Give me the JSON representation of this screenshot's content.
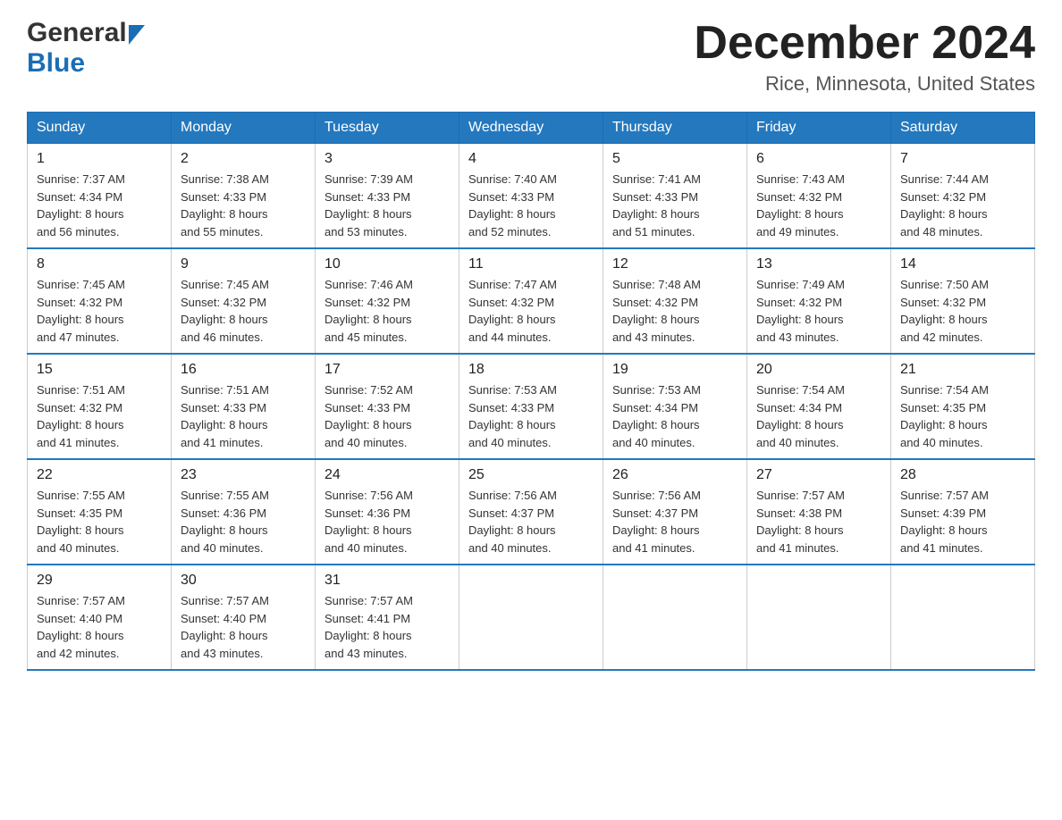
{
  "header": {
    "logo_general": "General",
    "logo_blue": "Blue",
    "month_title": "December 2024",
    "location": "Rice, Minnesota, United States"
  },
  "weekdays": [
    "Sunday",
    "Monday",
    "Tuesday",
    "Wednesday",
    "Thursday",
    "Friday",
    "Saturday"
  ],
  "weeks": [
    [
      {
        "day": "1",
        "sunrise": "7:37 AM",
        "sunset": "4:34 PM",
        "daylight": "8 hours and 56 minutes."
      },
      {
        "day": "2",
        "sunrise": "7:38 AM",
        "sunset": "4:33 PM",
        "daylight": "8 hours and 55 minutes."
      },
      {
        "day": "3",
        "sunrise": "7:39 AM",
        "sunset": "4:33 PM",
        "daylight": "8 hours and 53 minutes."
      },
      {
        "day": "4",
        "sunrise": "7:40 AM",
        "sunset": "4:33 PM",
        "daylight": "8 hours and 52 minutes."
      },
      {
        "day": "5",
        "sunrise": "7:41 AM",
        "sunset": "4:33 PM",
        "daylight": "8 hours and 51 minutes."
      },
      {
        "day": "6",
        "sunrise": "7:43 AM",
        "sunset": "4:32 PM",
        "daylight": "8 hours and 49 minutes."
      },
      {
        "day": "7",
        "sunrise": "7:44 AM",
        "sunset": "4:32 PM",
        "daylight": "8 hours and 48 minutes."
      }
    ],
    [
      {
        "day": "8",
        "sunrise": "7:45 AM",
        "sunset": "4:32 PM",
        "daylight": "8 hours and 47 minutes."
      },
      {
        "day": "9",
        "sunrise": "7:45 AM",
        "sunset": "4:32 PM",
        "daylight": "8 hours and 46 minutes."
      },
      {
        "day": "10",
        "sunrise": "7:46 AM",
        "sunset": "4:32 PM",
        "daylight": "8 hours and 45 minutes."
      },
      {
        "day": "11",
        "sunrise": "7:47 AM",
        "sunset": "4:32 PM",
        "daylight": "8 hours and 44 minutes."
      },
      {
        "day": "12",
        "sunrise": "7:48 AM",
        "sunset": "4:32 PM",
        "daylight": "8 hours and 43 minutes."
      },
      {
        "day": "13",
        "sunrise": "7:49 AM",
        "sunset": "4:32 PM",
        "daylight": "8 hours and 43 minutes."
      },
      {
        "day": "14",
        "sunrise": "7:50 AM",
        "sunset": "4:32 PM",
        "daylight": "8 hours and 42 minutes."
      }
    ],
    [
      {
        "day": "15",
        "sunrise": "7:51 AM",
        "sunset": "4:32 PM",
        "daylight": "8 hours and 41 minutes."
      },
      {
        "day": "16",
        "sunrise": "7:51 AM",
        "sunset": "4:33 PM",
        "daylight": "8 hours and 41 minutes."
      },
      {
        "day": "17",
        "sunrise": "7:52 AM",
        "sunset": "4:33 PM",
        "daylight": "8 hours and 40 minutes."
      },
      {
        "day": "18",
        "sunrise": "7:53 AM",
        "sunset": "4:33 PM",
        "daylight": "8 hours and 40 minutes."
      },
      {
        "day": "19",
        "sunrise": "7:53 AM",
        "sunset": "4:34 PM",
        "daylight": "8 hours and 40 minutes."
      },
      {
        "day": "20",
        "sunrise": "7:54 AM",
        "sunset": "4:34 PM",
        "daylight": "8 hours and 40 minutes."
      },
      {
        "day": "21",
        "sunrise": "7:54 AM",
        "sunset": "4:35 PM",
        "daylight": "8 hours and 40 minutes."
      }
    ],
    [
      {
        "day": "22",
        "sunrise": "7:55 AM",
        "sunset": "4:35 PM",
        "daylight": "8 hours and 40 minutes."
      },
      {
        "day": "23",
        "sunrise": "7:55 AM",
        "sunset": "4:36 PM",
        "daylight": "8 hours and 40 minutes."
      },
      {
        "day": "24",
        "sunrise": "7:56 AM",
        "sunset": "4:36 PM",
        "daylight": "8 hours and 40 minutes."
      },
      {
        "day": "25",
        "sunrise": "7:56 AM",
        "sunset": "4:37 PM",
        "daylight": "8 hours and 40 minutes."
      },
      {
        "day": "26",
        "sunrise": "7:56 AM",
        "sunset": "4:37 PM",
        "daylight": "8 hours and 41 minutes."
      },
      {
        "day": "27",
        "sunrise": "7:57 AM",
        "sunset": "4:38 PM",
        "daylight": "8 hours and 41 minutes."
      },
      {
        "day": "28",
        "sunrise": "7:57 AM",
        "sunset": "4:39 PM",
        "daylight": "8 hours and 41 minutes."
      }
    ],
    [
      {
        "day": "29",
        "sunrise": "7:57 AM",
        "sunset": "4:40 PM",
        "daylight": "8 hours and 42 minutes."
      },
      {
        "day": "30",
        "sunrise": "7:57 AM",
        "sunset": "4:40 PM",
        "daylight": "8 hours and 43 minutes."
      },
      {
        "day": "31",
        "sunrise": "7:57 AM",
        "sunset": "4:41 PM",
        "daylight": "8 hours and 43 minutes."
      },
      null,
      null,
      null,
      null
    ]
  ],
  "labels": {
    "sunrise": "Sunrise:",
    "sunset": "Sunset:",
    "daylight": "Daylight:"
  }
}
